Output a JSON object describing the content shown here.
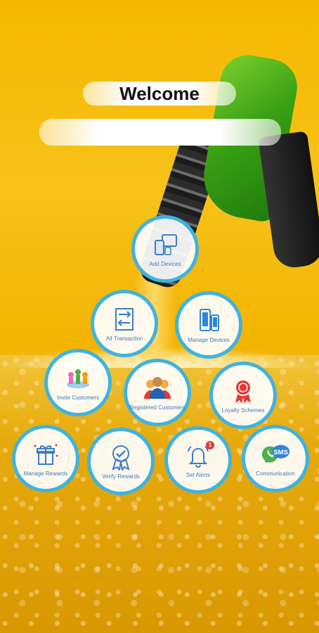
{
  "header": {
    "title": "Welcome",
    "name_value": ""
  },
  "menu": {
    "items": [
      {
        "label": "Add Devices",
        "icon": "devices-icon"
      },
      {
        "label": "All Transaction",
        "icon": "transaction-icon"
      },
      {
        "label": "Manage Devices",
        "icon": "phones-icon"
      },
      {
        "label": "Invite Customers",
        "icon": "invite-icon"
      },
      {
        "label": "Registered Customers",
        "icon": "customers-icon"
      },
      {
        "label": "Loyalty Schemes",
        "icon": "ribbon-icon"
      },
      {
        "label": "Manage Rewards",
        "icon": "gift-icon"
      },
      {
        "label": "Verify Rewards",
        "icon": "verify-badge-icon"
      },
      {
        "label": "Set Alerts",
        "icon": "bell-icon",
        "badge": "1"
      },
      {
        "label": "Communication",
        "icon": "sms-icon"
      }
    ]
  },
  "colors": {
    "ring": "#3fb3e0",
    "label": "#3a7fc4",
    "background": "#f5b800"
  }
}
